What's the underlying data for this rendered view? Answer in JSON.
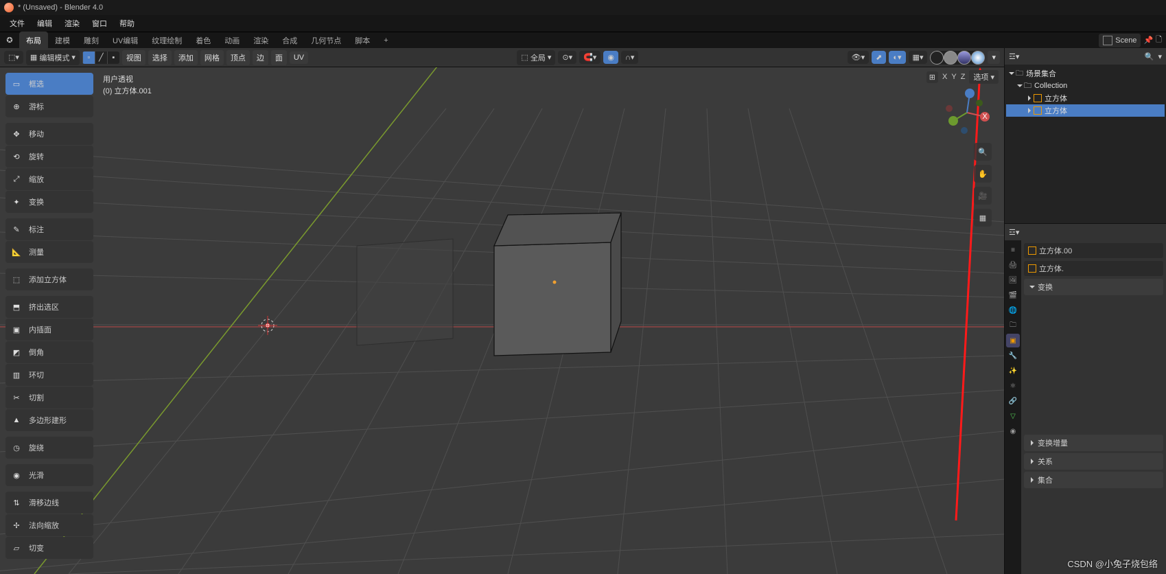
{
  "window": {
    "title": "* (Unsaved) - Blender 4.0"
  },
  "menubar": [
    "文件",
    "编辑",
    "渲染",
    "窗口",
    "帮助"
  ],
  "workspace_tabs": {
    "items": [
      "布局",
      "建模",
      "雕刻",
      "UV编辑",
      "纹理绘制",
      "着色",
      "动画",
      "渲染",
      "合成",
      "几何节点",
      "脚本"
    ],
    "active": "布局",
    "add": "+"
  },
  "scene": {
    "label": "Scene"
  },
  "header3d": {
    "mode": "编辑模式",
    "menus": [
      "视图",
      "选择",
      "添加",
      "网格",
      "顶点",
      "边",
      "面",
      "UV"
    ],
    "orientation": "全局"
  },
  "xyz_overlay": {
    "x": "X",
    "y": "Y",
    "z": "Z",
    "options": "选项"
  },
  "tools": [
    "框选",
    "游标",
    "移动",
    "旋转",
    "缩放",
    "变换",
    "标注",
    "测量",
    "添加立方体",
    "挤出选区",
    "内插面",
    "倒角",
    "环切",
    "切割",
    "多边形建形",
    "旋绕",
    "光滑",
    "滑移边线",
    "法向缩放",
    "切变"
  ],
  "overlay": {
    "persp": "用户透视",
    "obj": "(0) 立方体.001"
  },
  "outliner": {
    "scene_collection": "场景集合",
    "collection": "Collection",
    "items": [
      "立方体",
      "立方体"
    ]
  },
  "props": {
    "datablock": "立方体.00",
    "mesh": "立方体.",
    "panels": {
      "transform": "变换",
      "delta": "变换增量",
      "relations": "关系",
      "collections": "集合"
    }
  },
  "watermark": "CSDN @小兔子烧包络"
}
